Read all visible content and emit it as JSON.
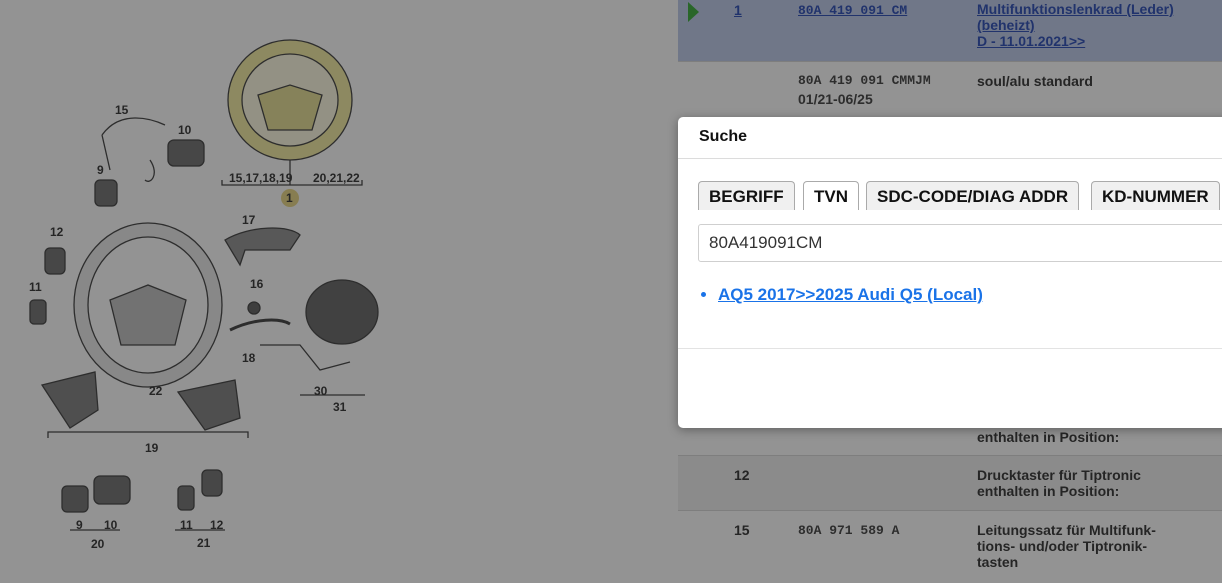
{
  "diagram": {
    "callouts": [
      "15",
      "10",
      "9",
      "15,17,18,19",
      "20,21,22",
      "1",
      "17",
      "12",
      "16",
      "11",
      "18",
      "22",
      "30",
      "31",
      "19",
      "9",
      "10",
      "11",
      "12",
      "20",
      "21"
    ]
  },
  "parts": {
    "rows": [
      {
        "pos": "1",
        "part_no": "80A 419 091 CM",
        "desc_lines": [
          "Multifunktionslenkrad (Leder)",
          "(beheizt)",
          "D - 11.01.2021>>"
        ],
        "selected": true
      },
      {
        "pos": "",
        "part_no": "80A 419 091 CMMJM",
        "date": "01/21-06/25",
        "desc_lines": [
          "soul/alu standard"
        ]
      },
      {
        "pos": "",
        "part_no": "",
        "desc_lines": [
          "enthalten in Position:"
        ]
      },
      {
        "pos": "12",
        "part_no": "",
        "desc_lines": [
          "Drucktaster für Tiptronic",
          "enthalten in Position:"
        ]
      },
      {
        "pos": "15",
        "part_no": "80A 971 589 A",
        "desc_lines": [
          "Leitungssatz für Multifunk-",
          "tions- und/oder Tiptronik-",
          "tasten"
        ]
      }
    ]
  },
  "modal": {
    "title": "Suche",
    "tabs": [
      "BEGRIFF",
      "TVN",
      "SDC-CODE/DIAG ADDR",
      "KD-NUMMER"
    ],
    "active_tab": "TVN",
    "search_value": "80A419091CM",
    "results": [
      "AQ5 2017>>2025 Audi Q5 (Local)"
    ]
  },
  "colors": {
    "overlay": "#282828",
    "selected_row": "#b8c6e8",
    "link": "#1a73e8",
    "arrow": "#2aa52a"
  }
}
